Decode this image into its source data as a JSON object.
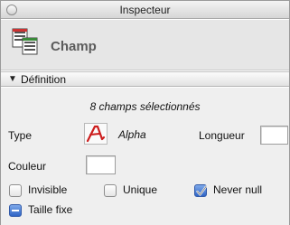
{
  "window": {
    "title": "Inspecteur"
  },
  "header": {
    "title": "Champ",
    "icon": "field-entity-icon"
  },
  "section": {
    "label": "Définition",
    "expanded": true
  },
  "definition": {
    "selection_text": "8 champs sélectionnés",
    "type_label": "Type",
    "type_value": "Alpha",
    "type_icon": "alpha-type-icon",
    "length_label": "Longueur",
    "length_value": "",
    "color_label": "Couleur",
    "color_value": "",
    "options": [
      {
        "label": "Invisible",
        "state": "unchecked"
      },
      {
        "label": "Unique",
        "state": "unchecked"
      },
      {
        "label": "Never null",
        "state": "checked"
      },
      {
        "label": "Taille fixe",
        "state": "mixed"
      }
    ]
  }
}
